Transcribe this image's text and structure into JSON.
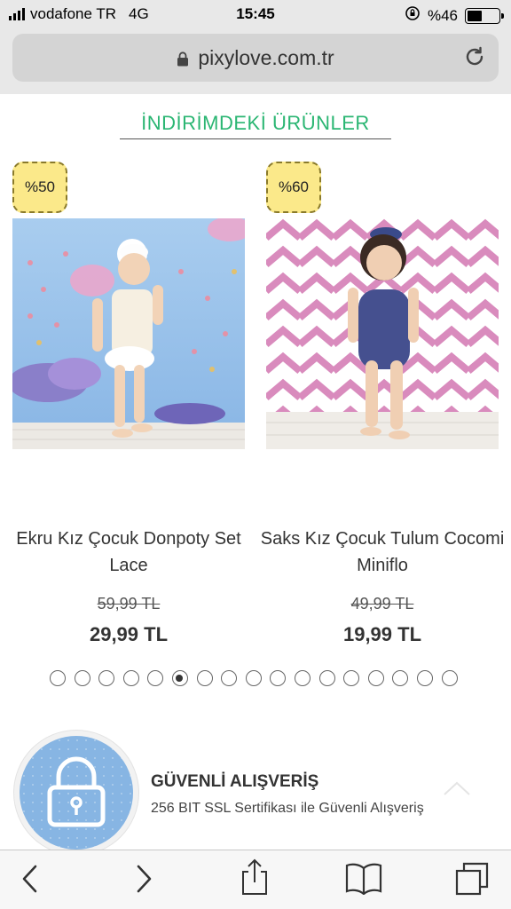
{
  "status_bar": {
    "carrier": "vodafone TR",
    "network": "4G",
    "time": "15:45",
    "battery": "%46",
    "battery_level": 0.46
  },
  "browser": {
    "url": "pixylove.com.tr",
    "icons": [
      "lock-icon",
      "reload-icon"
    ]
  },
  "section": {
    "title": "İNDİRİMDEKİ ÜRÜNLER"
  },
  "products": [
    {
      "discount": "%50",
      "name": "Ekru Kız Çocuk Donpoty Set Lace",
      "old_price": "59,99 TL",
      "new_price": "29,99 TL"
    },
    {
      "discount": "%60",
      "name": "Saks Kız Çocuk Tulum Cocomi Miniflo",
      "old_price": "49,99 TL",
      "new_price": "19,99 TL"
    }
  ],
  "carousel": {
    "total_dots": 17,
    "active_index": 5
  },
  "secure": {
    "title": "GÜVENLİ ALIŞVERİŞ",
    "subtitle": "256 BIT SSL Sertifikası ile Güvenli Alışveriş"
  },
  "toolbar": {
    "icons": [
      "back-icon",
      "forward-icon",
      "share-icon",
      "bookmarks-icon",
      "tabs-icon"
    ]
  },
  "colors": {
    "accent_green": "#2bb673",
    "badge_yellow": "#fbe98a",
    "secure_blue": "#87b5e3"
  }
}
